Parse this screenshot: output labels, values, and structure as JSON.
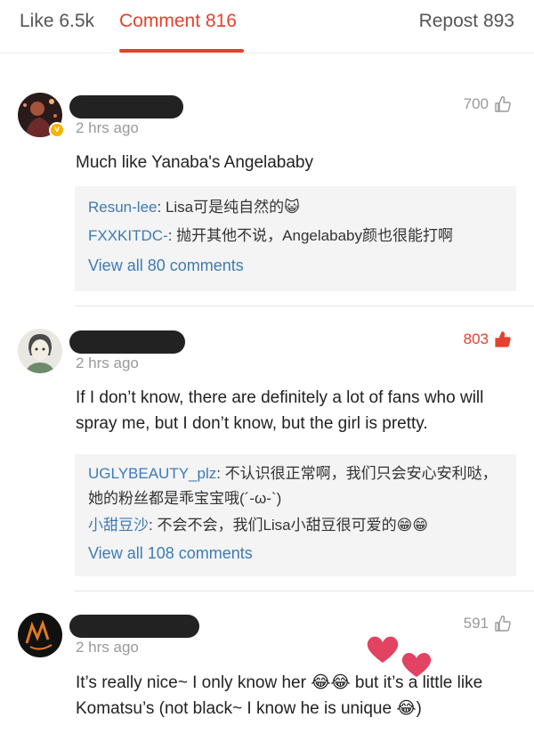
{
  "tabs": {
    "like": "Like 6.5k",
    "comment": "Comment 816",
    "repost": "Repost 893"
  },
  "comments": [
    {
      "time": "2 hrs ago",
      "likes": "700",
      "liked": false,
      "text": "Much like Yanaba's Angelababy",
      "replies": [
        {
          "user": "Resun-lee",
          "text": ": Lisa可是纯自然的😺"
        },
        {
          "user": "FXXKITDC-",
          "text": ": 抛开其他不说，Angelababy颜也很能打啊"
        }
      ],
      "view_all": "View all 80 comments"
    },
    {
      "time": "2 hrs ago",
      "likes": "803",
      "liked": true,
      "text": "If I don’t know, there are definitely a lot of fans who will spray me, but I don’t know, but the girl is pretty.",
      "replies": [
        {
          "user": "UGLYBEAUTY_plz",
          "text": ": 不认识很正常啊，我们只会安心安利哒，她的粉丝都是乖宝宝哦(´-ω-`)"
        },
        {
          "user": "小甜豆沙",
          "text": ": 不会不会，我们Lisa小甜豆很可爱的😁😁"
        }
      ],
      "view_all": "View all 108 comments"
    },
    {
      "time": "2 hrs ago",
      "likes": "591",
      "liked": false,
      "text": "It’s really nice~ I only know her 😂😂 but it’s a little like Komatsu’s (not black~ I know he is unique 😂)"
    }
  ],
  "colors": {
    "accent": "#e6412c",
    "link": "#3d7bb5",
    "reply_bg": "#f4f4f4"
  },
  "icons": {
    "like": "thumbs-up-icon",
    "verified": "verified-badge-icon"
  }
}
